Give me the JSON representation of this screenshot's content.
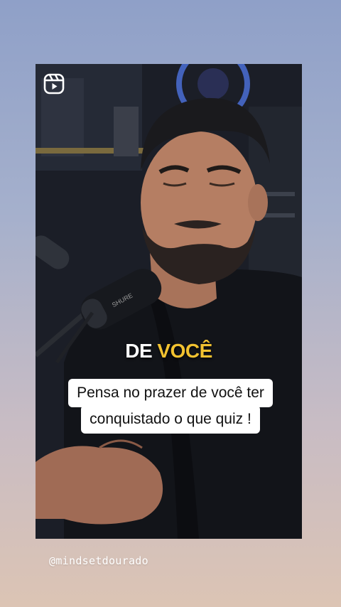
{
  "video": {
    "caption_word_1": "DE",
    "caption_word_2": "VOCÊ",
    "subtitle_line_1": "Pensa no prazer de você ter",
    "subtitle_line_2": "conquistado o que quiz !",
    "reels_icon": "reels-icon"
  },
  "mention": "@mindsetdourado",
  "colors": {
    "background_top": "#8fa0c8",
    "background_bottom": "#dcc4b4",
    "caption_highlight": "#f2c230",
    "subtitle_bg": "#ffffff"
  }
}
